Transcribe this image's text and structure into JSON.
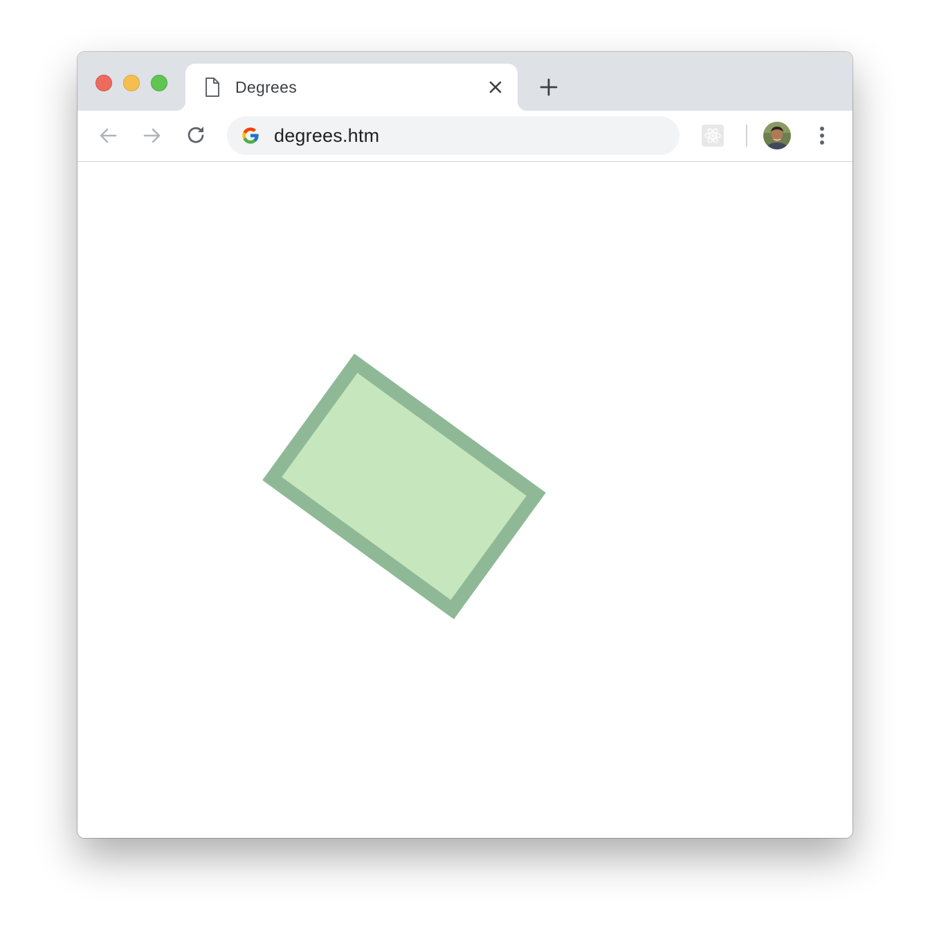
{
  "browser": {
    "tab": {
      "title": "Degrees",
      "icon": "document-icon"
    },
    "address_bar": {
      "url": "degrees.htm",
      "icon": "google-g-icon"
    },
    "extensions": [
      "react-devtools-icon"
    ],
    "colors": {
      "tabstrip": "#dee1e6",
      "omnibox": "#f1f3f4",
      "traffic_close": "#ed6a5e",
      "traffic_minimize": "#f5bf4f",
      "traffic_maximize": "#61c554"
    }
  },
  "page": {
    "shape": {
      "type": "rectangle",
      "rotation_deg": 36,
      "fill": "#c6e6bd",
      "stroke": "#8fb996"
    }
  }
}
